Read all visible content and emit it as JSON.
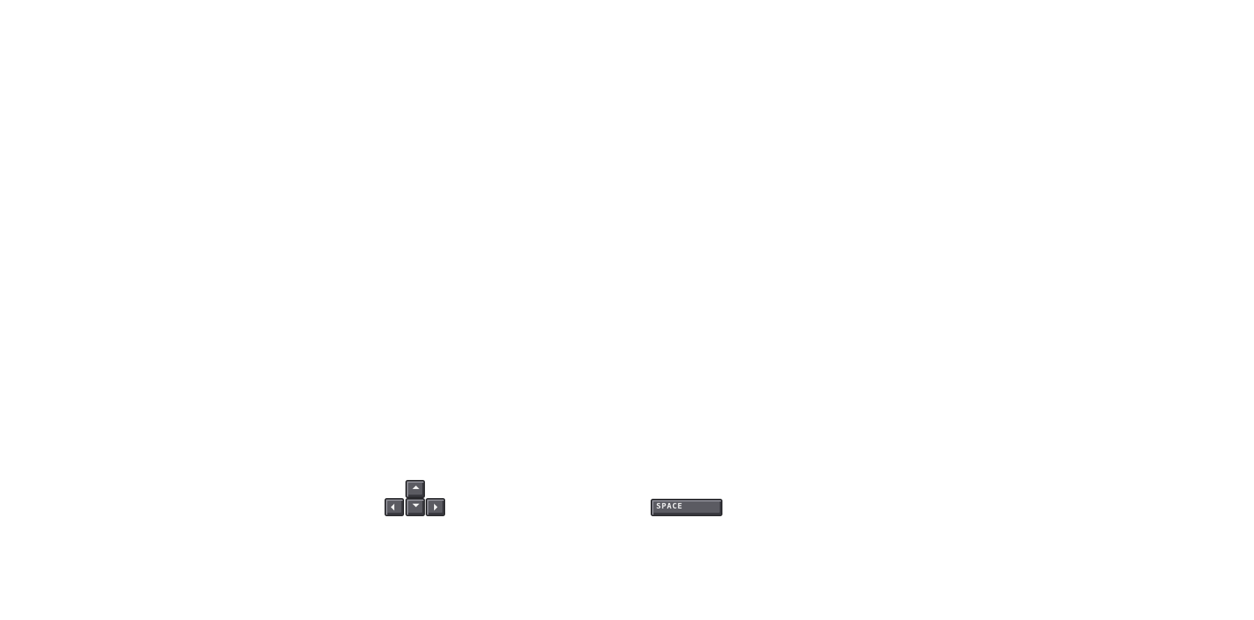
{
  "controls": {
    "move_keys": {
      "up_icon": "arrow-up-icon",
      "left_icon": "arrow-left-icon",
      "down_icon": "arrow-down-icon",
      "right_icon": "arrow-right-icon"
    },
    "action_key": {
      "label": "SPACE"
    }
  },
  "colors": {
    "background": "#ffffff",
    "key_face": "#5b5b62",
    "key_border": "#2a2a2e",
    "key_glyph": "#f2f2f2"
  }
}
